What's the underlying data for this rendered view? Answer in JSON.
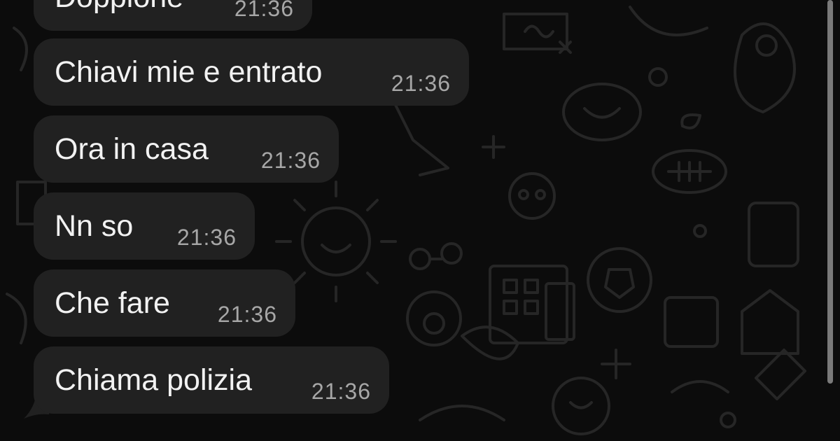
{
  "messages": [
    {
      "text": "Doppione",
      "time": "21:36"
    },
    {
      "text": "Chiavi mie e entrato",
      "time": "21:36"
    },
    {
      "text": "Ora in casa",
      "time": "21:36"
    },
    {
      "text": "Nn so",
      "time": "21:36"
    },
    {
      "text": "Che fare",
      "time": "21:36"
    },
    {
      "text": "Chiama polizia",
      "time": "21:36"
    }
  ],
  "colors": {
    "background": "#0c0c0c",
    "bubble": "#212121",
    "text": "#f2f2f2",
    "time": "#a7a7a7"
  }
}
